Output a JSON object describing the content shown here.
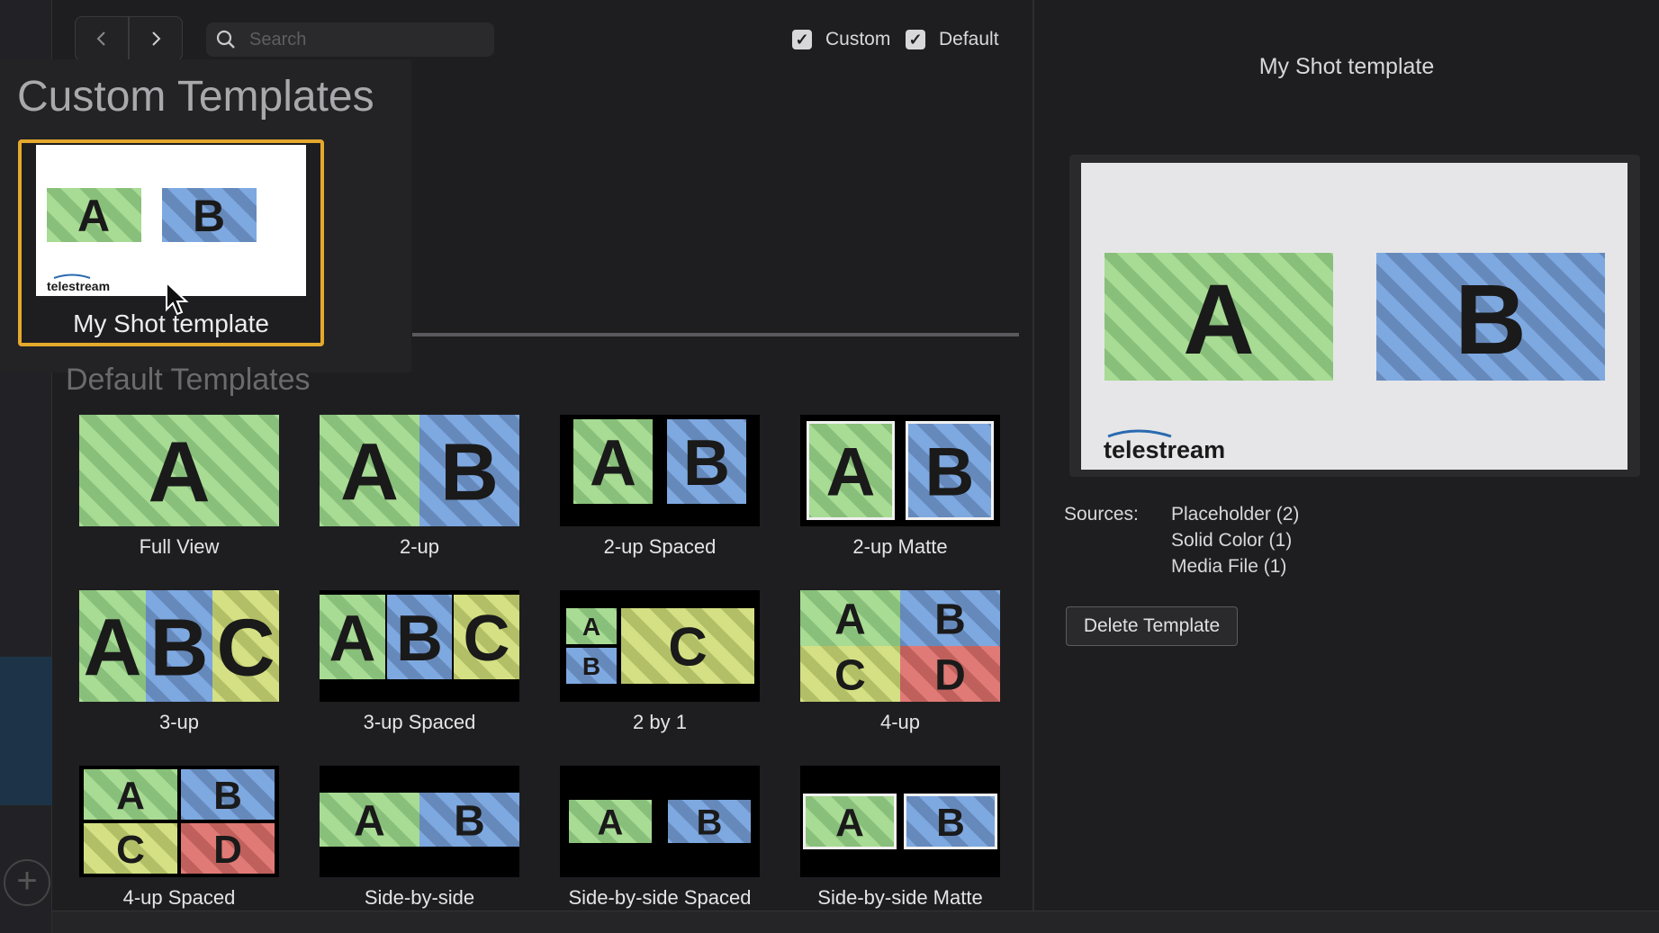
{
  "toolbar": {
    "back_icon": "chevron-left-icon",
    "forward_icon": "chevron-right-icon",
    "search_placeholder": "Search",
    "filters": [
      {
        "label": "Custom",
        "checked": true
      },
      {
        "label": "Default",
        "checked": true
      }
    ]
  },
  "custom_section": {
    "heading": "Custom Templates",
    "items": [
      {
        "label": "My Shot template",
        "selected": true,
        "logo": "telestream"
      }
    ]
  },
  "default_section": {
    "heading": "Default Templates",
    "items": [
      {
        "label": "Full View"
      },
      {
        "label": "2-up"
      },
      {
        "label": "2-up Spaced"
      },
      {
        "label": "2-up Matte"
      },
      {
        "label": "3-up"
      },
      {
        "label": "3-up Spaced"
      },
      {
        "label": "2 by 1"
      },
      {
        "label": "4-up"
      },
      {
        "label": "4-up Spaced"
      },
      {
        "label": "Side-by-side"
      },
      {
        "label": "Side-by-side Spaced"
      },
      {
        "label": "Side-by-side Matte"
      }
    ]
  },
  "inspector": {
    "title": "My Shot template",
    "logo": "telestream",
    "sources_label": "Sources:",
    "sources": [
      "Placeholder (2)",
      "Solid Color (1)",
      "Media File (1)"
    ],
    "delete_label": "Delete Template"
  },
  "colors": {
    "selection": "#e4a92c",
    "green": "#a8db94",
    "blue": "#7ea8e0",
    "yellow": "#d4e083",
    "red": "#e07a76"
  }
}
